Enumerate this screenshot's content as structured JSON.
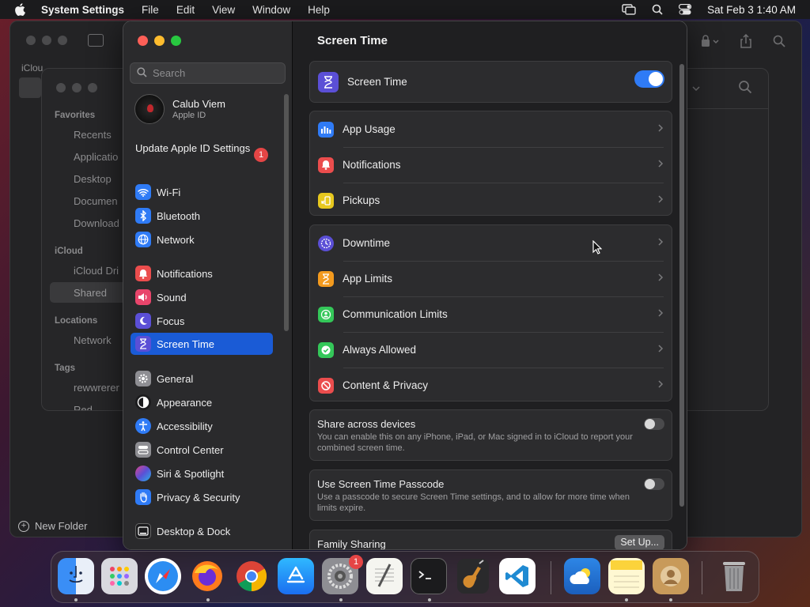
{
  "menubar": {
    "app": "System Settings",
    "items": [
      "File",
      "Edit",
      "View",
      "Window",
      "Help"
    ],
    "datetime": "Sat Feb 3  1:40 AM"
  },
  "finder": {
    "icloud_label": "iClou",
    "sections": {
      "favorites": "Favorites",
      "icloud": "iCloud",
      "locations": "Locations",
      "tags": "Tags"
    },
    "favorites": [
      "Recents",
      "Applicatio",
      "Desktop",
      "Documen",
      "Download"
    ],
    "icloud_items": [
      "iCloud Dri",
      "Shared"
    ],
    "locations": [
      "Network"
    ],
    "tags": [
      "rewwrerer",
      "Red"
    ],
    "new_folder": "New Folder"
  },
  "settings": {
    "search_placeholder": "Search",
    "account": {
      "name": "Calub Viem",
      "sub": "Apple ID"
    },
    "update": {
      "label": "Update Apple ID Settings",
      "badge": "1"
    },
    "sidebar": [
      {
        "label": "Wi-Fi",
        "icon": "wifi-icon",
        "color": "#2f7bf6"
      },
      {
        "label": "Bluetooth",
        "icon": "bluetooth-icon",
        "color": "#2f7bf6"
      },
      {
        "label": "Network",
        "icon": "globe-icon",
        "color": "#2f7bf6"
      },
      {
        "label": "Notifications",
        "icon": "bell-icon",
        "color": "#eb4d4d"
      },
      {
        "label": "Sound",
        "icon": "speaker-icon",
        "color": "#e8456b"
      },
      {
        "label": "Focus",
        "icon": "moon-icon",
        "color": "#5b4fd6"
      },
      {
        "label": "Screen Time",
        "icon": "hourglass-icon",
        "color": "#5b4fd6"
      },
      {
        "label": "General",
        "icon": "gear-icon",
        "color": "#8e8e93"
      },
      {
        "label": "Appearance",
        "icon": "appearance-icon",
        "color": "#1c1c1e"
      },
      {
        "label": "Accessibility",
        "icon": "accessibility-icon",
        "color": "#2f7bf6"
      },
      {
        "label": "Control Center",
        "icon": "control-center-icon",
        "color": "#8e8e93"
      },
      {
        "label": "Siri & Spotlight",
        "icon": "siri-icon",
        "color": "#b44fd6"
      },
      {
        "label": "Privacy & Security",
        "icon": "hand-icon",
        "color": "#2f7bf6"
      },
      {
        "label": "Desktop & Dock",
        "icon": "dock-icon",
        "color": "#1c1c1e"
      }
    ],
    "page_title": "Screen Time",
    "screen_time_toggle": {
      "label": "Screen Time",
      "on": true
    },
    "group1": [
      {
        "label": "App Usage",
        "icon": "chart-bars-icon",
        "color": "#2f7bf6"
      },
      {
        "label": "Notifications",
        "icon": "bell-icon",
        "color": "#eb4d4d"
      },
      {
        "label": "Pickups",
        "icon": "pickup-icon",
        "color": "#e7c81e"
      }
    ],
    "group2": [
      {
        "label": "Downtime",
        "icon": "downtime-icon",
        "color": "#5b4fd6"
      },
      {
        "label": "App Limits",
        "icon": "hourglass-icon",
        "color": "#f39a1e"
      },
      {
        "label": "Communication Limits",
        "icon": "person-icon",
        "color": "#34c759"
      },
      {
        "label": "Always Allowed",
        "icon": "checkmark-icon",
        "color": "#34c759"
      },
      {
        "label": "Content & Privacy",
        "icon": "no-sign-icon",
        "color": "#eb4d4d"
      }
    ],
    "share": {
      "title": "Share across devices",
      "desc": "You can enable this on any iPhone, iPad, or Mac signed in to iCloud to report your combined screen time.",
      "on": false
    },
    "passcode": {
      "title": "Use Screen Time Passcode",
      "desc": "Use a passcode to secure Screen Time settings, and to allow for more time when limits expire.",
      "on": false
    },
    "family": {
      "title": "Family Sharing",
      "button": "Set Up..."
    }
  },
  "dock": {
    "items": [
      "Finder",
      "Launchpad",
      "Safari",
      "Firefox",
      "Chrome",
      "App Store",
      "System Settings",
      "TextEdit",
      "Terminal",
      "GarageBand",
      "VS Code",
      "Weather",
      "Notes",
      "Contacts",
      "Trash"
    ],
    "settings_badge": "1"
  }
}
